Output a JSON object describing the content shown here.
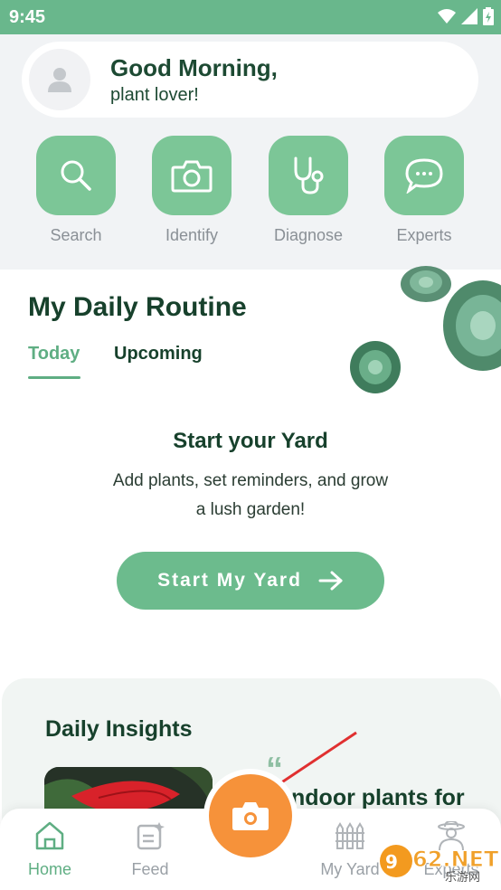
{
  "status": {
    "time": "9:45"
  },
  "greeting": {
    "title": "Good Morning,",
    "subtitle": "plant lover!"
  },
  "actions": [
    {
      "label": "Search",
      "icon": "search-icon"
    },
    {
      "label": "Identify",
      "icon": "camera-icon"
    },
    {
      "label": "Diagnose",
      "icon": "stethoscope-icon"
    },
    {
      "label": "Experts",
      "icon": "chat-icon"
    }
  ],
  "routine": {
    "title": "My Daily Routine",
    "tabs": [
      "Today",
      "Upcoming"
    ],
    "empty_title": "Start your Yard",
    "empty_desc": "Add plants, set reminders, and grow a lush garden!",
    "button": "Start My Yard"
  },
  "insights": {
    "title": "Daily Insights",
    "quote_mark": "“",
    "article_text": "ndoor plants for"
  },
  "nav": {
    "items": [
      {
        "label": "Home",
        "icon": "home-icon"
      },
      {
        "label": "Feed",
        "icon": "feed-icon"
      },
      {
        "label": "My Yard",
        "icon": "fence-icon"
      },
      {
        "label": "Experts",
        "icon": "expert-icon"
      }
    ]
  },
  "watermark": {
    "text": "962.NET",
    "sub": "乐游网"
  },
  "colors": {
    "brand": "#69b78c",
    "accent": "#f6923a",
    "dark_text": "#17412c"
  }
}
